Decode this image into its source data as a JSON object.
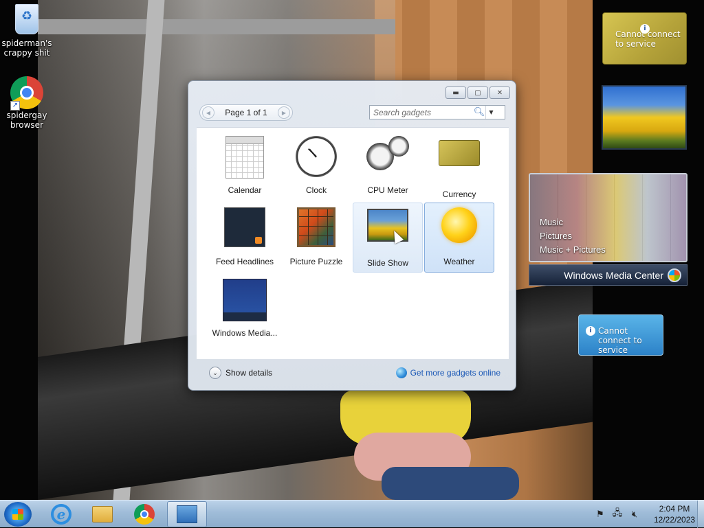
{
  "desktop": {
    "icons": [
      {
        "label": "spiderman's crappy shit",
        "icon": "recycle-bin-icon"
      },
      {
        "label": "spidergay browser",
        "icon": "chrome-icon"
      }
    ]
  },
  "gadget_window": {
    "pager_label": "Page 1 of 1",
    "search_placeholder": "Search gadgets",
    "gadgets": [
      {
        "name": "Calendar",
        "icon": "calendar-icon"
      },
      {
        "name": "Clock",
        "icon": "clock-icon"
      },
      {
        "name": "CPU Meter",
        "icon": "cpu-meter-icon"
      },
      {
        "name": "Currency",
        "icon": "currency-icon"
      },
      {
        "name": "Feed Headlines",
        "icon": "feed-headlines-icon"
      },
      {
        "name": "Picture Puzzle",
        "icon": "picture-puzzle-icon"
      },
      {
        "name": "Slide Show",
        "icon": "slide-show-icon"
      },
      {
        "name": "Weather",
        "icon": "weather-icon"
      },
      {
        "name": "Windows Media...",
        "icon": "windows-media-center-icon"
      }
    ],
    "hovered": "Slide Show",
    "selected": "Weather",
    "show_details": "Show details",
    "get_more": "Get more gadgets online"
  },
  "sidebar": {
    "currency_status": "Cannot connect to service",
    "weather_status": "Cannot connect to service",
    "wmc_menu": [
      "Music",
      "Pictures",
      "Music + Pictures"
    ],
    "wmc_title": "Windows Media Center"
  },
  "taskbar": {
    "pinned": [
      "internet-explorer-icon",
      "file-explorer-icon",
      "chrome-icon",
      "desktop-gadgets-icon"
    ],
    "active": "desktop-gadgets-icon",
    "time": "2:04 PM",
    "date": "12/22/2023"
  }
}
